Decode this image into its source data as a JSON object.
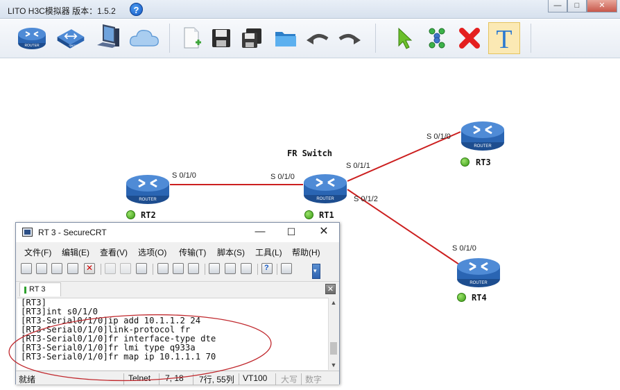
{
  "app": {
    "title": "LITO H3C模拟器 版本：1.5.2",
    "help_glyph": "?",
    "window_controls": {
      "minimize": "—",
      "maximize": "□",
      "close": "✕"
    }
  },
  "toolbar": {
    "tools": [
      {
        "name": "router-tool-icon",
        "text": "ROUTER"
      },
      {
        "name": "switch-tool-icon",
        "text": "SWITCH"
      },
      {
        "name": "pc-tool-icon"
      },
      {
        "name": "cloud-tool-icon"
      },
      {
        "name": "new-file-icon"
      },
      {
        "name": "save-icon"
      },
      {
        "name": "save-as-icon"
      },
      {
        "name": "open-folder-icon"
      },
      {
        "name": "undo-icon"
      },
      {
        "name": "redo-icon"
      },
      {
        "name": "select-pointer-icon"
      },
      {
        "name": "connect-link-icon"
      },
      {
        "name": "delete-icon"
      },
      {
        "name": "text-tool-icon",
        "text": "T"
      }
    ]
  },
  "topology": {
    "router_caption": "ROUTER",
    "devices": [
      {
        "id": "RT1",
        "caption": "FR Switch"
      },
      {
        "id": "RT2"
      },
      {
        "id": "RT3"
      },
      {
        "id": "RT4"
      }
    ],
    "port_labels": {
      "rt2_s010": "S 0/1/0",
      "rt1_s010": "S 0/1/0",
      "rt1_s011": "S 0/1/1",
      "rt1_s012": "S 0/1/2",
      "rt3_s010": "S 0/1/0",
      "rt4_s010": "S 0/1/0"
    },
    "link_color": "#cc1f1f",
    "status_color": "#3a9b15"
  },
  "securecrt": {
    "title": "RT 3 - SecureCRT",
    "menu": [
      "文件(F)",
      "编辑(E)",
      "查看(V)",
      "选项(O)",
      "传输(T)",
      "脚本(S)",
      "工具(L)",
      "帮助(H)"
    ],
    "tab_label": "RT 3",
    "terminal_lines": [
      "[RT3]",
      "[RT3]int s0/1/0",
      "[RT3-Serial0/1/0]ip add 10.1.1.2 24",
      "[RT3-Serial0/1/0]link-protocol fr",
      "[RT3-Serial0/1/0]fr interface-type dte",
      "[RT3-Serial0/1/0]fr lmi type q933a",
      "[RT3-Serial0/1/0]fr map ip 10.1.1.1 70"
    ],
    "status": {
      "ready": "就绪",
      "protocol": "Telnet",
      "cursor": "7,  18",
      "rows_cols": "7行, 55列",
      "emulation": "VT100",
      "caps": "大写",
      "num": "数字"
    }
  },
  "annotation_color": "#c0282d"
}
